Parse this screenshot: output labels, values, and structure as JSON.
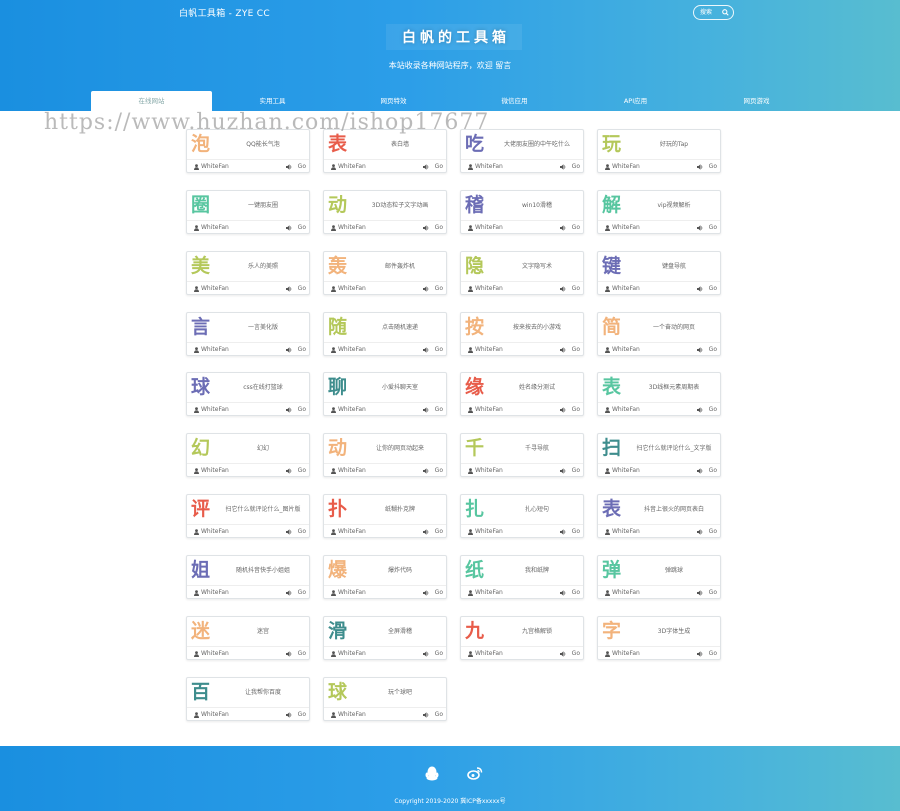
{
  "header": {
    "site_name": "白帆工具箱 - ZYE CC",
    "search_placeholder": "搜索",
    "title_chars": [
      "白",
      "帆",
      "的",
      "工",
      "具",
      "箱"
    ],
    "subtitle": "本站收录各种网站程序，欢迎 留言",
    "tabs": [
      "在线网站",
      "实用工具",
      "网页特效",
      "微信应用",
      "API应用",
      "网页游戏"
    ],
    "active_tab": 0
  },
  "watermark": "https://www.huzhan.com/ishop17677",
  "cards": [
    {
      "char": "泡",
      "color": "#f2b37c",
      "desc": "QQ能长气泡",
      "author": "WhiteFan",
      "go": "Go"
    },
    {
      "char": "表",
      "color": "#e85c4a",
      "desc": "表白墙",
      "author": "WhiteFan",
      "go": "Go"
    },
    {
      "char": "吃",
      "color": "#6c6db5",
      "desc": "大佬朋友圈的中午吃什么",
      "author": "WhiteFan",
      "go": "Go"
    },
    {
      "char": "玩",
      "color": "#b4c85a",
      "desc": "好玩的Tap",
      "author": "WhiteFan",
      "go": "Go"
    },
    {
      "char": "圈",
      "color": "#58c6a0",
      "desc": "一键朋友圈",
      "author": "WhiteFan",
      "go": "Go"
    },
    {
      "char": "动",
      "color": "#b4c85a",
      "desc": "3D动态粒子文字动画",
      "author": "WhiteFan",
      "go": "Go"
    },
    {
      "char": "稽",
      "color": "#6c6db5",
      "desc": "win10滑稽",
      "author": "WhiteFan",
      "go": "Go"
    },
    {
      "char": "解",
      "color": "#58c6a0",
      "desc": "vip视频解析",
      "author": "WhiteFan",
      "go": "Go"
    },
    {
      "char": "美",
      "color": "#b4c85a",
      "desc": "乐人的美照",
      "author": "WhiteFan",
      "go": "Go"
    },
    {
      "char": "轰",
      "color": "#f2b37c",
      "desc": "邮件轰炸机",
      "author": "WhiteFan",
      "go": "Go"
    },
    {
      "char": "隐",
      "color": "#b4c85a",
      "desc": "文字隐写术",
      "author": "WhiteFan",
      "go": "Go"
    },
    {
      "char": "键",
      "color": "#6c6db5",
      "desc": "键盘导航",
      "author": "WhiteFan",
      "go": "Go"
    },
    {
      "char": "言",
      "color": "#6c6db5",
      "desc": "一言美化版",
      "author": "WhiteFan",
      "go": "Go"
    },
    {
      "char": "随",
      "color": "#b4c85a",
      "desc": "点击随机速递",
      "author": "WhiteFan",
      "go": "Go"
    },
    {
      "char": "按",
      "color": "#f2b37c",
      "desc": "按来按去的小游戏",
      "author": "WhiteFan",
      "go": "Go"
    },
    {
      "char": "简",
      "color": "#f2b37c",
      "desc": "一个奋动的网页",
      "author": "WhiteFan",
      "go": "Go"
    },
    {
      "char": "球",
      "color": "#6c6db5",
      "desc": "css在线打篮球",
      "author": "WhiteFan",
      "go": "Go"
    },
    {
      "char": "聊",
      "color": "#3e8d8d",
      "desc": "小爱抖聊天室",
      "author": "WhiteFan",
      "go": "Go"
    },
    {
      "char": "缘",
      "color": "#e85c4a",
      "desc": "姓名缘分测试",
      "author": "WhiteFan",
      "go": "Go"
    },
    {
      "char": "表",
      "color": "#58c6a0",
      "desc": "3D线框元素周期表",
      "author": "WhiteFan",
      "go": "Go"
    },
    {
      "char": "幻",
      "color": "#b4c85a",
      "desc": "幻幻",
      "author": "WhiteFan",
      "go": "Go"
    },
    {
      "char": "动",
      "color": "#f2b37c",
      "desc": "让你的网页动起来",
      "author": "WhiteFan",
      "go": "Go"
    },
    {
      "char": "千",
      "color": "#b4c85a",
      "desc": "千寻导航",
      "author": "WhiteFan",
      "go": "Go"
    },
    {
      "char": "扫",
      "color": "#3e8d8d",
      "desc": "扫它什么就评论什么_文字版",
      "author": "WhiteFan",
      "go": "Go"
    },
    {
      "char": "评",
      "color": "#e85c4a",
      "desc": "扫它什么就评论什么_图片版",
      "author": "WhiteFan",
      "go": "Go"
    },
    {
      "char": "扑",
      "color": "#e85c4a",
      "desc": "纸糊扑克牌",
      "author": "WhiteFan",
      "go": "Go"
    },
    {
      "char": "扎",
      "color": "#58c6a0",
      "desc": "扎心短句",
      "author": "WhiteFan",
      "go": "Go"
    },
    {
      "char": "表",
      "color": "#6c6db5",
      "desc": "抖音上很火的网页表白",
      "author": "WhiteFan",
      "go": "Go"
    },
    {
      "char": "姐",
      "color": "#6c6db5",
      "desc": "随机抖音快手小姐姐",
      "author": "WhiteFan",
      "go": "Go"
    },
    {
      "char": "爆",
      "color": "#f2b37c",
      "desc": "爆炸代码",
      "author": "WhiteFan",
      "go": "Go"
    },
    {
      "char": "纸",
      "color": "#58c6a0",
      "desc": "我和纸牌",
      "author": "WhiteFan",
      "go": "Go"
    },
    {
      "char": "弹",
      "color": "#58c6a0",
      "desc": "弹跳球",
      "author": "WhiteFan",
      "go": "Go"
    },
    {
      "char": "迷",
      "color": "#f2b37c",
      "desc": "迷宫",
      "author": "WhiteFan",
      "go": "Go"
    },
    {
      "char": "滑",
      "color": "#3e8d8d",
      "desc": "全屏滑稽",
      "author": "WhiteFan",
      "go": "Go"
    },
    {
      "char": "九",
      "color": "#e85c4a",
      "desc": "九宫格解锁",
      "author": "WhiteFan",
      "go": "Go"
    },
    {
      "char": "字",
      "color": "#f2b37c",
      "desc": "3D字体生成",
      "author": "WhiteFan",
      "go": "Go"
    },
    {
      "char": "百",
      "color": "#3e8d8d",
      "desc": "让我帮你百度",
      "author": "WhiteFan",
      "go": "Go"
    },
    {
      "char": "球",
      "color": "#b4c85a",
      "desc": "玩个球吧",
      "author": "WhiteFan",
      "go": "Go"
    }
  ],
  "footer": {
    "copyright": "Copyright 2019-2020   冀ICP备xxxxx号"
  }
}
